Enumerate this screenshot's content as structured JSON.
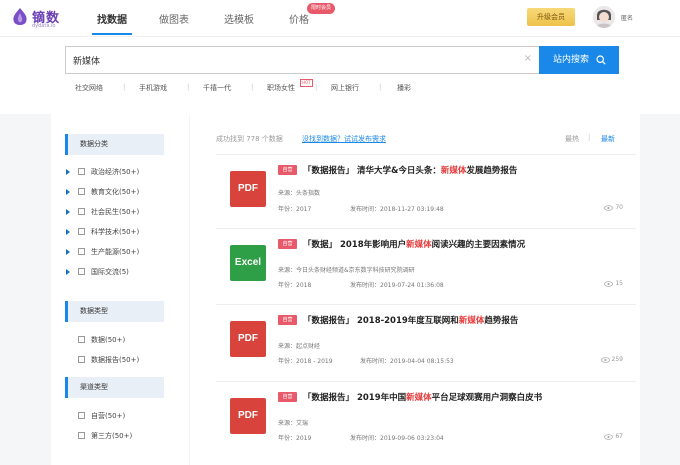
{
  "logo": {
    "cn": "镝数",
    "en": "dydata.io"
  },
  "nav": [
    {
      "label": "找数据"
    },
    {
      "label": "做图表"
    },
    {
      "label": "选模板"
    },
    {
      "label": "价格"
    }
  ],
  "nav_badge": "限时会员",
  "upgrade_label": "升级会员",
  "username": "匿名",
  "search": {
    "value": "新媒体",
    "button_label": "站内搜索"
  },
  "hot_words": [
    "社交网络",
    "手机游戏",
    "千禧一代",
    "职场女性",
    "网上银行",
    "播彩"
  ],
  "hot_tag": "HOT",
  "sidebar": {
    "section1": {
      "title": "数据分类",
      "items": [
        "政治经济(50+)",
        "教育文化(50+)",
        "社会民生(50+)",
        "科学技术(50+)",
        "生产能源(50+)",
        "国际交流(5)"
      ]
    },
    "section2": {
      "title": "数据类型",
      "items": [
        "数据(50+)",
        "数据报告(50+)"
      ]
    },
    "section3": {
      "title": "渠道类型",
      "items": [
        "自营(50+)",
        "第三方(50+)"
      ]
    }
  },
  "results": {
    "count": "成功找到 778 个数据",
    "link": "没找到数据？试试发布需求",
    "sort_hot": "最热",
    "sort_new": "最新"
  },
  "items": [
    {
      "icon": "PDF",
      "tag": "自营",
      "title_pre": "「数据报告」 清华大学&今日头条：",
      "title_hl": "新媒体",
      "title_post": "发展趋势报告",
      "source": "来源：头条指数",
      "year": "年份：2017",
      "date": "发布时间：2018-11-27 03:19:48",
      "views": "70"
    },
    {
      "icon": "Excel",
      "tag": "自营",
      "title_pre": "「数据」 2018年影响用户",
      "title_hl": "新媒体",
      "title_post": "阅读兴趣的主要因素情况",
      "source": "来源：今日头条财经频道&京东数字科技研究院调研",
      "year": "年份：2018",
      "date": "发布时间：2019-07-24 01:36:08",
      "views": "15"
    },
    {
      "icon": "PDF",
      "tag": "自营",
      "title_pre": "「数据报告」 2018-2019年度互联网和",
      "title_hl": "新媒体",
      "title_post": "趋势报告",
      "source": "来源：起点财经",
      "year": "年份：2018 - 2019",
      "date": "发布时间：2019-04-04 08:15:53",
      "views": "259"
    },
    {
      "icon": "PDF",
      "tag": "自营",
      "title_pre": "「数据报告」 2019年中国",
      "title_hl": "新媒体",
      "title_post": "平台足球观赛用户洞察白皮书",
      "source": "来源：艾瑞",
      "year": "年份：2019",
      "date": "发布时间：2019-09-06 03:23:04",
      "views": "67"
    }
  ]
}
